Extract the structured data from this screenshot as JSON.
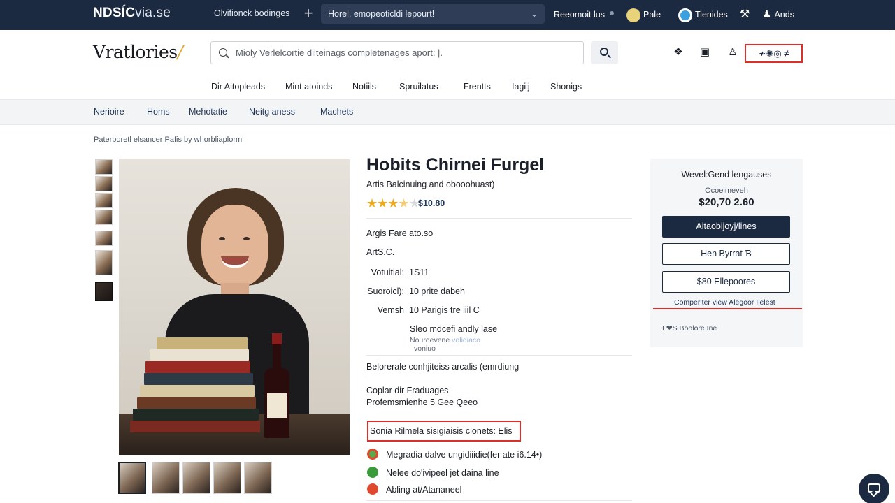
{
  "topbar": {
    "brand_bold": "NDSÍC",
    "brand_light": "via.se",
    "link": "Olvifionck bodinges",
    "search_text": "Horel, emopeoticldi lepourt!",
    "items": [
      {
        "label": "Reeomoit lus"
      },
      {
        "label": "Pale",
        "icon": "globe-icon",
        "color": "#e8d27a"
      },
      {
        "label": "Tienides",
        "icon": "circle-user-icon",
        "color": "#3aa0e0"
      },
      {
        "label": "",
        "icon": "tool-icon"
      },
      {
        "label": "Ands",
        "icon": "person-icon"
      }
    ]
  },
  "header": {
    "logo_main": "Vratlories",
    "logo_accent": "/",
    "search_placeholder": "Mioly Verlelcortie dilteinags completenages aport: |.",
    "account_label": "≁✺◎ ≠"
  },
  "category_nav": [
    "Dir Aitopleads",
    "Mint atoinds",
    "Notiils",
    "Spruilatus",
    "Frentts",
    "Iagiij",
    "Shonigs"
  ],
  "sub_nav": [
    "Nerioire",
    "Homs",
    "Mehotatie",
    "Neitg aness",
    "Machets"
  ],
  "breadcrumb": "Paterporetl elsancer Pafis by whorbliaplorm",
  "product": {
    "title": "Hobits Chirnei Furgel",
    "subtitle": "Artis Balcinuing and obooohuast)",
    "rating": 3.5,
    "rating_max": 5,
    "price": "$10.80",
    "line1": "Argis Fare ato.so",
    "line2": "ArtS.C.",
    "specs": [
      {
        "k": "Votuitial:",
        "v": "1S11"
      },
      {
        "k": "Suoroicl):",
        "v": "10 prite dabeh"
      },
      {
        "k": "Vemsh",
        "v": "10 Parigis tre iiil C"
      }
    ],
    "spec_note": "Sleo mdcefi andly lase",
    "spec_note_small": "Nouroevene",
    "spec_note_blue": "volidiaco",
    "spec_note_small2": "voniuo",
    "feature_line": "Belorerale conhjiteiss arcalis (emrdiung",
    "copy_title": "Coplar dir Fraduages",
    "copy_sub": "Profemsmienhe 5 Gee Qeeo",
    "highlight": "Sonia Rilmela sisigiaisis clonets: Elis",
    "features": [
      {
        "text": "Megradia dalve ungidiiidie(fer ate i6.14•)",
        "icon": "leaf-icon",
        "color": "#5aa84a"
      },
      {
        "text": "Nelee do'ivipeel jet daina line",
        "icon": "check-icon",
        "color": "#3a9a3a"
      },
      {
        "text": "Abling at/Atananeel",
        "icon": "badge-icon",
        "color": "#e0482d"
      }
    ]
  },
  "buybox": {
    "title": "Wevel:Gend lengauses",
    "price_label": "Ocoeimeveh",
    "price": "$20,70 2.60",
    "primary_btn": "Aitaobijoyj/lines",
    "btn2": "Hen Byrrat Ɓ",
    "btn3": "$80 Ellepoores",
    "compare": "Comperiter view Alegoor Ilelest",
    "footer": "I ❤S Boolore Ine"
  }
}
